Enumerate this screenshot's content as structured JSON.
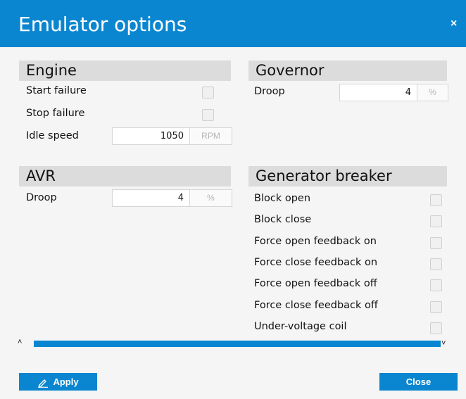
{
  "window": {
    "title": "Emulator options",
    "close_icon": "×"
  },
  "engine": {
    "title": "Engine",
    "start_failure": "Start failure",
    "stop_failure": "Stop failure",
    "idle_speed_label": "Idle speed",
    "idle_speed_value": "1050",
    "idle_speed_unit": "RPM"
  },
  "governor": {
    "title": "Governor",
    "droop_label": "Droop",
    "droop_value": "4",
    "droop_unit": "%"
  },
  "avr": {
    "title": "AVR",
    "droop_label": "Droop",
    "droop_value": "4",
    "droop_unit": "%"
  },
  "generator_breaker": {
    "title": "Generator breaker",
    "items": [
      "Block open",
      "Block close",
      "Force open feedback on",
      "Force close feedback on",
      "Force open feedback off",
      "Force close feedback off",
      "Under-voltage coil"
    ]
  },
  "scroll": {
    "up_icon": "˄",
    "down_icon": "˅"
  },
  "footer": {
    "apply_label": "Apply",
    "close_label": "Close"
  },
  "colors": {
    "accent": "#0a86d0",
    "section_header": "#dcdcdc",
    "background": "#f5f5f5"
  }
}
